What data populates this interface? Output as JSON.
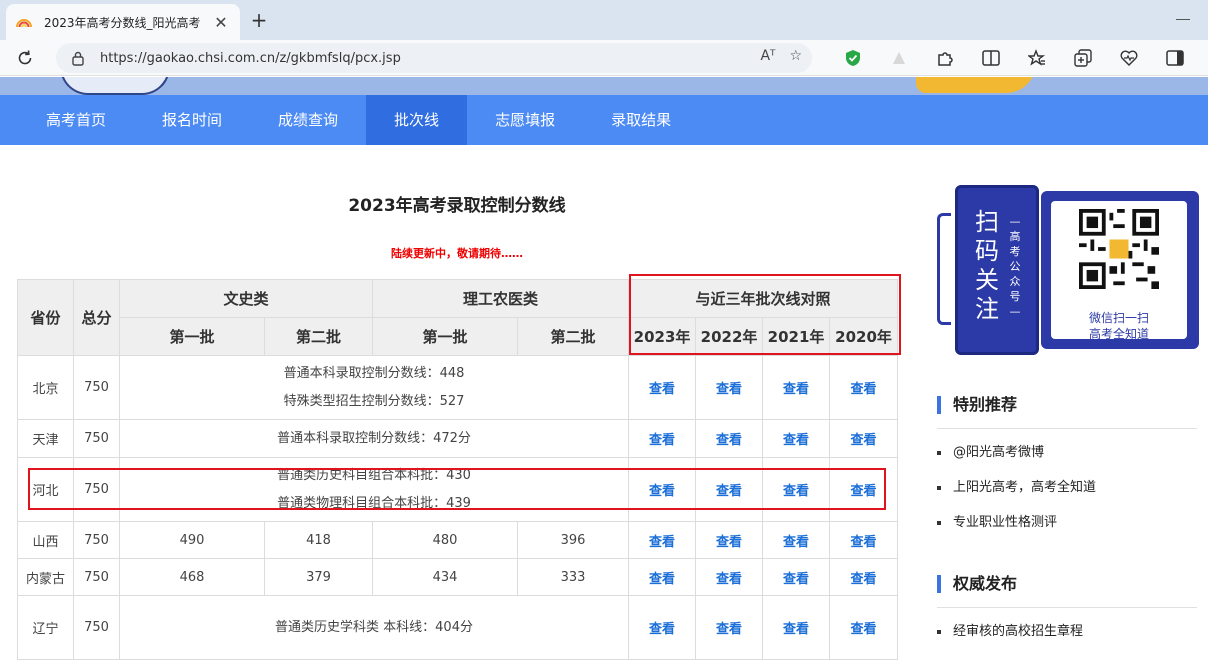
{
  "browser": {
    "tab_title": "2023年高考分数线_阳光高考",
    "tab_close": "✕",
    "new_tab": "+",
    "url": "https://gaokao.chsi.com.cn/z/gkbmfslq/pcx.jsp",
    "read_aloud": "Aᵀ",
    "favorite": "☆"
  },
  "nav": {
    "items": [
      "高考首页",
      "报名时间",
      "成绩查询",
      "批次线",
      "志愿填报",
      "录取结果"
    ],
    "active_index": 3
  },
  "main": {
    "title": "2023年高考录取控制分数线",
    "notice": "陆续更新中，敬请期待……"
  },
  "table": {
    "headers": {
      "province": "省份",
      "total": "总分",
      "wenshi": "文史类",
      "ligong": "理工农医类",
      "compare": "与近三年批次线对照",
      "batch1": "第一批",
      "batch2": "第二批",
      "years": [
        "2023年",
        "2022年",
        "2021年",
        "2020年"
      ]
    },
    "view_label": "查看",
    "rows": [
      {
        "province": "北京",
        "total": "750",
        "merged": [
          "普通本科录取控制分数线：448",
          "特殊类型招生控制分数线：527"
        ]
      },
      {
        "province": "天津",
        "total": "750",
        "merged": [
          "普通本科录取控制分数线：472分"
        ]
      },
      {
        "province": "河北",
        "total": "750",
        "merged": [
          "普通类历史科目组合本科批：430",
          "普通类物理科目组合本科批：439"
        ]
      },
      {
        "province": "山西",
        "total": "750",
        "cells": [
          "490",
          "418",
          "480",
          "396"
        ]
      },
      {
        "province": "内蒙古",
        "total": "750",
        "cells": [
          "468",
          "379",
          "434",
          "333"
        ]
      },
      {
        "province": "辽宁",
        "total": "750",
        "merged": [
          "普通类历史学科类 本科线：404分",
          ""
        ]
      }
    ]
  },
  "sidebar": {
    "qr_big": "扫码关注",
    "qr_small": "—高考公众号—",
    "qr_caption1": "微信扫一扫",
    "qr_caption2": "高考全知道",
    "recommend_title": "特别推荐",
    "recommend": [
      "@阳光高考微博",
      "上阳光高考，高考全知道",
      "专业职业性格测评"
    ],
    "release_title": "权威发布",
    "release": [
      "经审核的高校招生章程"
    ]
  },
  "colors": {
    "nav_bg": "#4d8bf4",
    "nav_active": "#2f6de0",
    "link": "#1d6fd8",
    "notice": "#e00000",
    "highlight_box": "#e0141e",
    "qr_blue": "#2b3aa6"
  }
}
